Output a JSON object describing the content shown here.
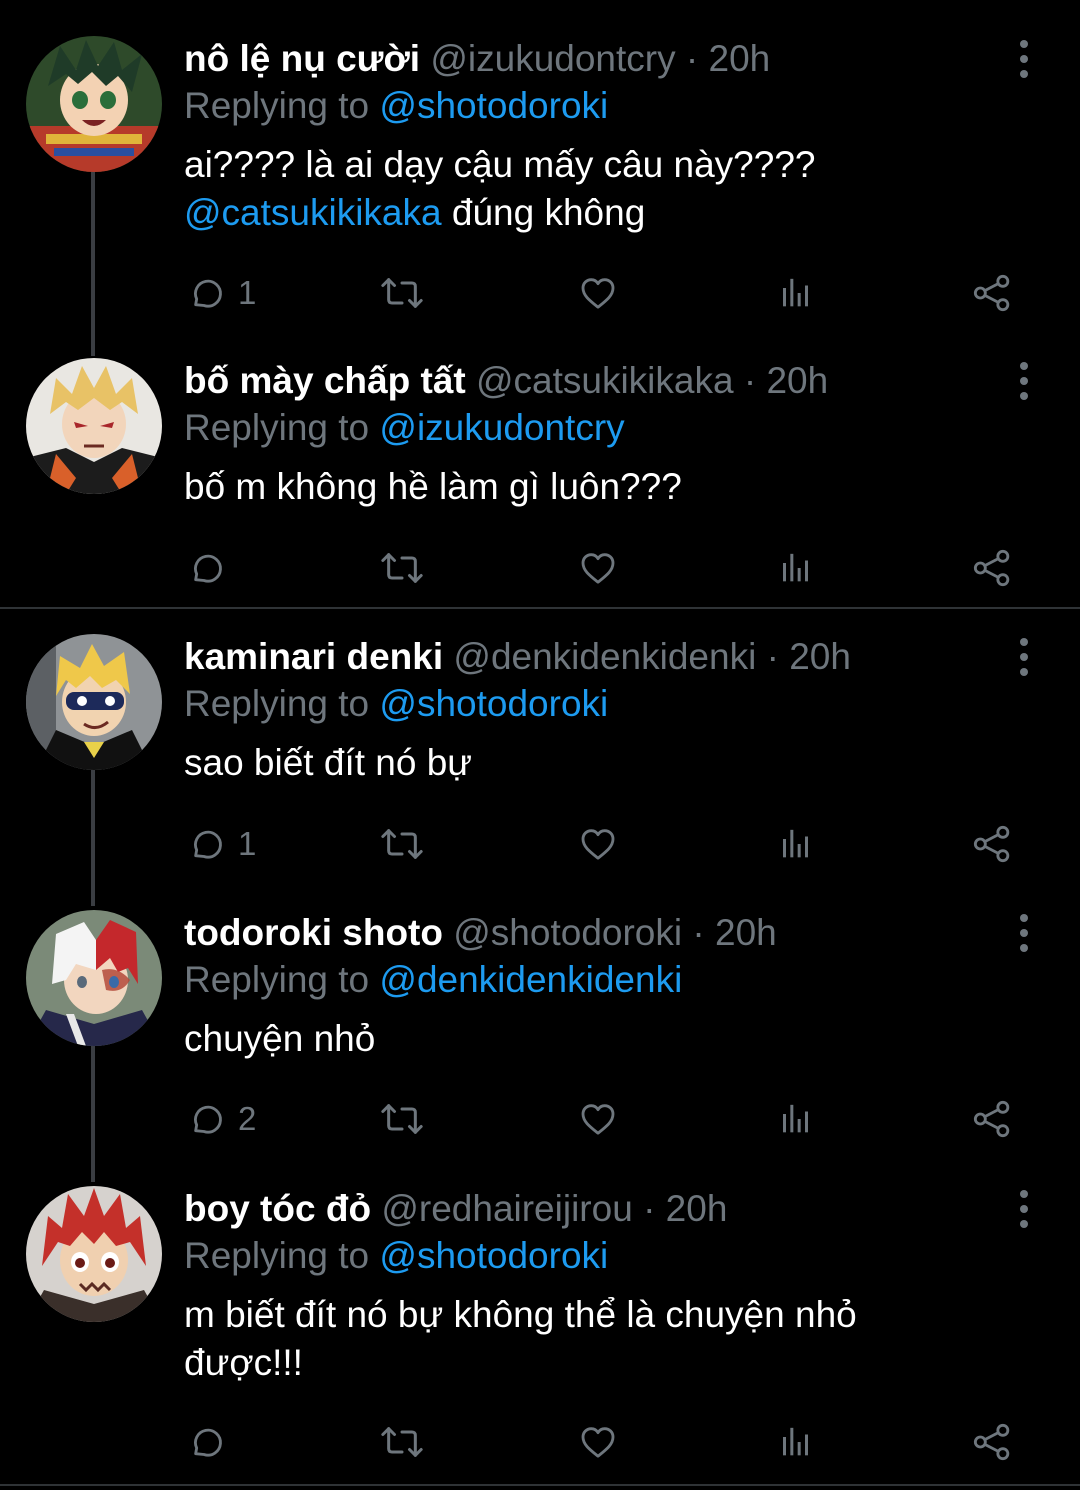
{
  "colors": {
    "background": "#000000",
    "mention": "#1d9bf0",
    "muted": "#6e767d"
  },
  "icons": [
    "reply-icon",
    "retweet-icon",
    "like-icon",
    "stats-icon",
    "share-icon",
    "more-icon"
  ],
  "tweets": [
    {
      "display_name": "nô lệ nụ cười",
      "handle": "@izukudontcry",
      "time": "· 20h",
      "reply_prefix": "Replying to",
      "reply_to": "@shotodoroki",
      "text_line1": "ai???? là ai dạy cậu mấy câu này????",
      "text_mention": "@catsukikikaka",
      "text_line2_rest": " đúng không",
      "reply_count": "1"
    },
    {
      "display_name": "bố mày chấp tất",
      "handle": "@catsukikikaka",
      "time": "· 20h",
      "reply_prefix": "Replying to",
      "reply_to": "@izukudontcry",
      "text": "bố m không hề làm gì luôn???",
      "reply_count": ""
    },
    {
      "display_name": "kaminari denki",
      "handle": "@denkidenkidenki",
      "time": "· 20h",
      "reply_prefix": "Replying to",
      "reply_to": "@shotodoroki",
      "text": "sao biết đít nó bự",
      "reply_count": "1"
    },
    {
      "display_name": "todoroki shoto",
      "handle": "@shotodoroki",
      "time": "· 20h",
      "reply_prefix": "Replying to",
      "reply_to": "@denkidenkidenki",
      "text": "chuyện nhỏ",
      "reply_count": "2"
    },
    {
      "display_name": "boy tóc đỏ",
      "handle": "@redhaireijirou",
      "time": "· 20h",
      "reply_prefix": "Replying to",
      "reply_to": "@shotodoroki",
      "text_line1": "m biết đít nó bự không thể là chuyện nhỏ",
      "text_line2": "được!!!",
      "reply_count": ""
    }
  ]
}
